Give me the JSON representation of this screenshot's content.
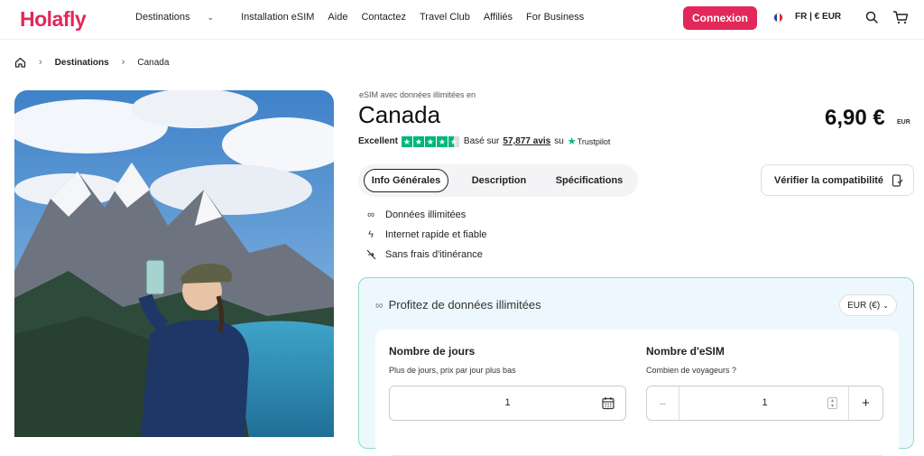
{
  "brand": {
    "logo": "Holafly",
    "accent": "#e2285a"
  },
  "nav": {
    "items": [
      {
        "label": "Destinations",
        "has_dropdown": true
      },
      {
        "label": "Installation eSIM"
      },
      {
        "label": "Aide"
      },
      {
        "label": "Contactez"
      },
      {
        "label": "Travel Club"
      },
      {
        "label": "Affiliés"
      },
      {
        "label": "For Business"
      }
    ],
    "login_label": "Connexion",
    "locale_label": "FR | € EUR",
    "icons": [
      "search-icon",
      "cart-icon"
    ]
  },
  "breadcrumb": {
    "level1": "Destinations",
    "level2": "Canada"
  },
  "product": {
    "kicker": "eSIM avec données illimitées en",
    "title": "Canada",
    "price": "6,90 €",
    "currency": "EUR",
    "rating": {
      "label": "Excellent",
      "stars": 4.5,
      "based_on": "Basé sur",
      "count": "57,877 avis",
      "on": "su",
      "provider": "Trustpilot"
    },
    "tabs": [
      "Info Générales",
      "Description",
      "Spécifications"
    ],
    "active_tab": 0,
    "compat_label": "Vérifier la compatibilité",
    "features": [
      {
        "icon": "infinity-icon",
        "label": "Données illimitées"
      },
      {
        "icon": "bolt-icon",
        "label": "Internet rapide et fiable"
      },
      {
        "icon": "no-roaming-icon",
        "label": "Sans frais d'itinérance"
      }
    ]
  },
  "booking": {
    "title": "Profitez de données illimitées",
    "currency_select": "EUR (€)",
    "days": {
      "label": "Nombre de jours",
      "hint": "Plus de jours, prix par jour plus bas",
      "value": "1"
    },
    "esims": {
      "label": "Nombre d'eSIM",
      "hint": "Combien de voyageurs ?",
      "value": "1"
    }
  }
}
